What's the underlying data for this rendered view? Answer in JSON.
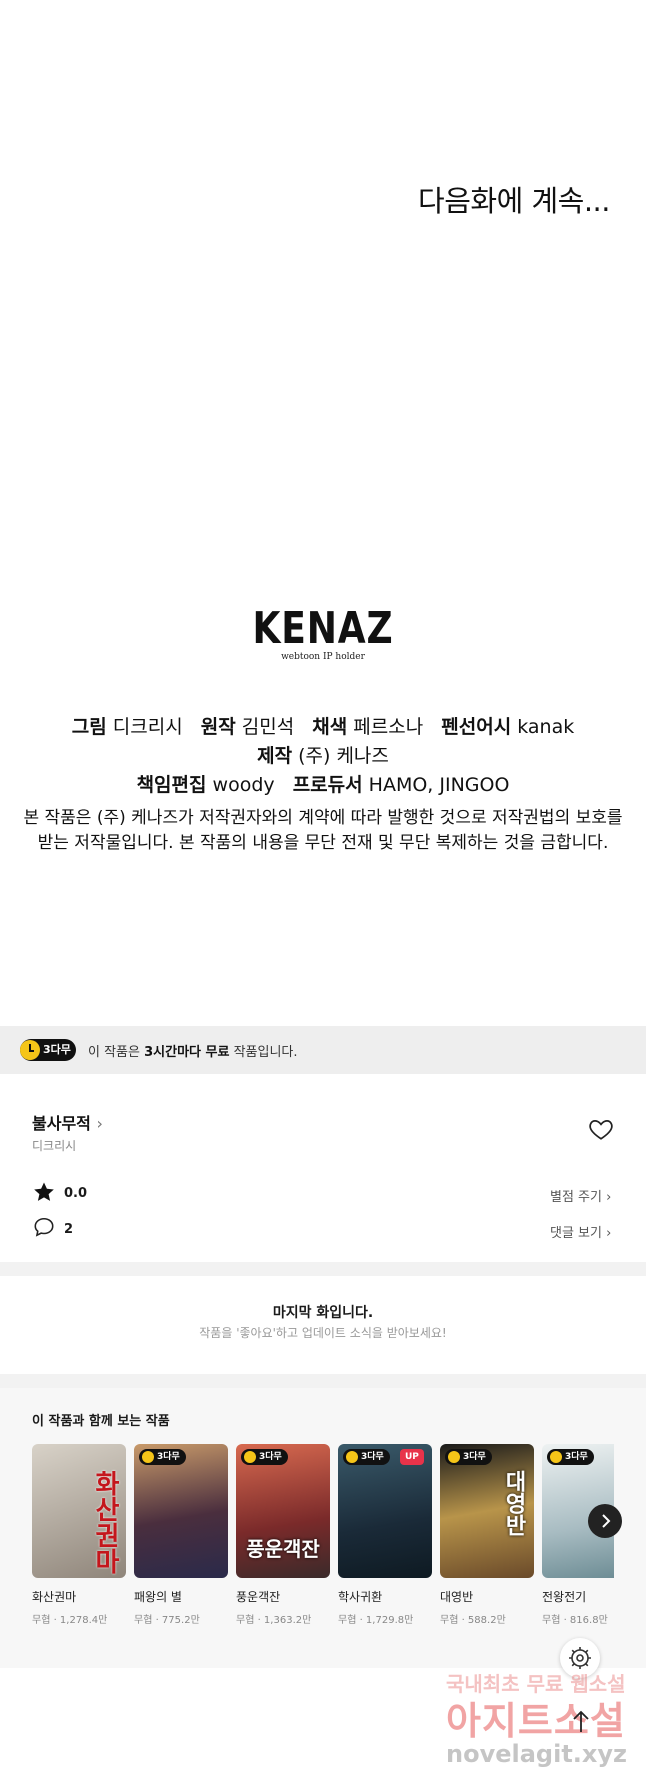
{
  "episode_end": {
    "to_be_continued": "다음화에 계속...",
    "logo": {
      "main": "KENAZ",
      "sub": "webtoon IP holder"
    },
    "credits": {
      "art_label": "그림",
      "art": "디크리시",
      "original_label": "원작",
      "original": "김민석",
      "color_label": "채색",
      "color": "페르소나",
      "pencil_label": "펜선어시",
      "pencil": "kanak",
      "production_label": "제작",
      "production": "(주) 케나즈",
      "editor_label": "책임편집",
      "editor": "woody",
      "producer_label": "프로듀서",
      "producer": "HAMO, JINGOO"
    },
    "copyright_line1": "본 작품은 (주) 케나즈가 저작권자와의 계약에 따라 발행한 것으로 저작권법의 보호를",
    "copyright_line2": "받는 저작물입니다. 본 작품의 내용을 무단 전재 및 무단 복제하는 것을 금합니다."
  },
  "free_banner": {
    "badge": "3다무",
    "text_prefix": "이 작품은 ",
    "text_bold": "3시간마다 무료",
    "text_suffix": " 작품입니다."
  },
  "work": {
    "title": "불사무적",
    "title_chevron": "›",
    "author": "디크리시",
    "rating": "0.0",
    "rate_link": "별점 주기 ›",
    "comments": "2",
    "comments_link": "댓글 보기 ›"
  },
  "last_episode": {
    "title": "마지막 화입니다.",
    "subtitle": "작품을 '좋아요'하고 업데이트 소식을 받아보세요!"
  },
  "recommendations": {
    "title": "이 작품과 함께 보는 작품",
    "items": [
      {
        "name": "화산권마",
        "meta": "무협 · 1,278.4만",
        "badge": "",
        "cover_text": "화산권마",
        "cover_color": "#b9b2a6"
      },
      {
        "name": "패왕의 별",
        "meta": "무협 · 775.2만",
        "badge": "3다무",
        "cover_text": "",
        "cover_color": "#6a4a3e"
      },
      {
        "name": "풍운객잔",
        "meta": "무협 · 1,363.2만",
        "badge": "3다무",
        "cover_text": "풍운객잔",
        "cover_color": "#b4524a"
      },
      {
        "name": "학사귀환",
        "meta": "무협 · 1,729.8만",
        "badge": "3다무",
        "up": "UP",
        "cover_text": "",
        "cover_color": "#20303e"
      },
      {
        "name": "대영반",
        "meta": "무협 · 588.2만",
        "badge": "3다무",
        "cover_text": "대영반",
        "cover_color": "#b89a5a"
      },
      {
        "name": "전왕전기",
        "meta": "무협 · 816.8만",
        "badge": "3다무",
        "cover_text": "",
        "cover_color": "#cfd6d8"
      }
    ]
  },
  "watermark": {
    "line1": "국내최초 무료 웹소설",
    "line2": "아지트소설",
    "line3": "novelagit.xyz"
  }
}
